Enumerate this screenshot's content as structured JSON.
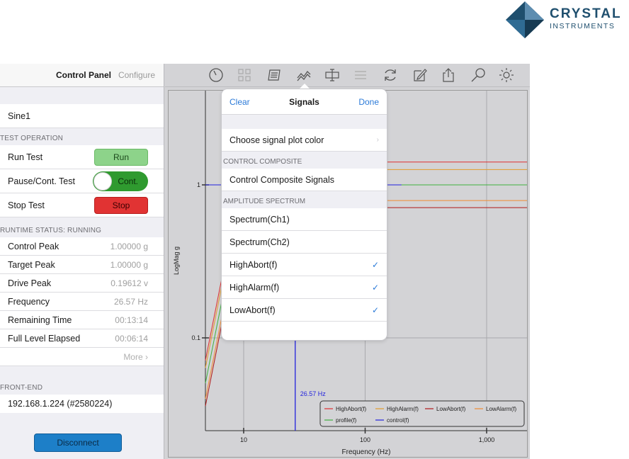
{
  "logo": {
    "line1": "CRYSTAL",
    "line2": "INSTRUMENTS",
    "color": "#1f4f6e"
  },
  "left_panel": {
    "header": {
      "title": "Control Panel",
      "configure": "Configure"
    },
    "test_name": "Sine1",
    "test_operation": {
      "section": "TEST OPERATION",
      "run_label": "Run Test",
      "run_button": "Run",
      "pause_label": "Pause/Cont. Test",
      "pause_toggle": "Cont.",
      "stop_label": "Stop Test",
      "stop_button": "Stop"
    },
    "runtime_status": {
      "section": "RUNTIME STATUS: RUNNING",
      "rows": [
        {
          "label": "Control Peak",
          "value": "1.00000 g"
        },
        {
          "label": "Target Peak",
          "value": "1.00000 g"
        },
        {
          "label": "Drive Peak",
          "value": "0.19612 v"
        },
        {
          "label": "Frequency",
          "value": "26.57 Hz"
        },
        {
          "label": "Remaining Time",
          "value": "00:13:14"
        },
        {
          "label": "Full Level Elapsed",
          "value": "00:06:14"
        }
      ],
      "more": "More"
    },
    "front_end": {
      "section": "FRONT-END",
      "device": "192.168.1.224 (#2580224)",
      "disconnect": "Disconnect"
    }
  },
  "toolbar": {
    "icons": [
      "clock-icon",
      "grid-icon",
      "list-icon",
      "signal-icon",
      "cursor-icon",
      "lines-icon",
      "refresh-icon",
      "note-icon",
      "share-icon",
      "search-icon",
      "gear-icon"
    ]
  },
  "popover": {
    "clear": "Clear",
    "title": "Signals",
    "done": "Done",
    "plot_color": "Choose signal plot color",
    "control_section": "CONTROL COMPOSITE",
    "control_item": "Control Composite Signals",
    "amplitude_section": "AMPLITUDE SPECTRUM",
    "items": [
      {
        "label": "Spectrum(Ch1)",
        "checked": false
      },
      {
        "label": "Spectrum(Ch2)",
        "checked": false
      },
      {
        "label": "HighAbort(f)",
        "checked": true
      },
      {
        "label": "HighAlarm(f)",
        "checked": true
      },
      {
        "label": "LowAbort(f)",
        "checked": true
      }
    ]
  },
  "chart_data": {
    "type": "line",
    "xlabel": "Frequency (Hz)",
    "ylabel": "LogMag g",
    "x_scale": "log",
    "y_scale": "log",
    "x_ticks": [
      "10",
      "100",
      "1,000"
    ],
    "y_ticks": [
      "1",
      "0.1"
    ],
    "marker_label": "26.57 Hz",
    "marker_x": 26.57,
    "legend": {
      "placement": "bottom-right",
      "entries": [
        {
          "name": "HighAbort(f)",
          "color": "#e03030"
        },
        {
          "name": "HighAlarm(f)",
          "color": "#e39b2a"
        },
        {
          "name": "LowAbort(f)",
          "color": "#b01818"
        },
        {
          "name": "LowAlarm(f)",
          "color": "#f08a30"
        },
        {
          "name": "profile(f)",
          "color": "#3fb13f"
        },
        {
          "name": "control(f)",
          "color": "#2222dd"
        }
      ]
    },
    "series": [
      {
        "name": "HighAbort(f)",
        "level": 1.41,
        "color": "#e03030"
      },
      {
        "name": "HighAlarm(f)",
        "level": 1.26,
        "color": "#e39b2a"
      },
      {
        "name": "profile(f)",
        "level": 1.0,
        "color": "#3fb13f"
      },
      {
        "name": "LowAlarm(f)",
        "level": 0.79,
        "color": "#f08a30"
      },
      {
        "name": "LowAbort(f)",
        "level": 0.71,
        "color": "#b01818"
      },
      {
        "name": "control(f)",
        "level": 1.0,
        "color": "#2222dd"
      }
    ]
  }
}
